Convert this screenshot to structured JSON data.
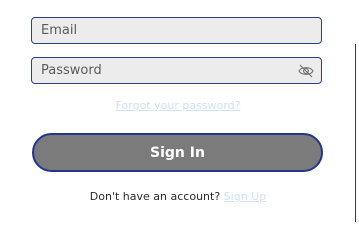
{
  "form": {
    "email": {
      "placeholder": "Email",
      "value": ""
    },
    "password": {
      "placeholder": "Password",
      "value": "",
      "toggle_icon": "eye-slash-icon"
    },
    "forgot_password_link": "Forgot your password?",
    "submit_label": "Sign In",
    "no_account_text": "Don't have an account?",
    "signup_link": "Sign Up"
  },
  "colors": {
    "field_border": "#2d3f8c",
    "field_background": "#ececec",
    "button_background": "#7b7b7b",
    "button_border": "#23358f",
    "link_color": "#cfe2f6"
  }
}
